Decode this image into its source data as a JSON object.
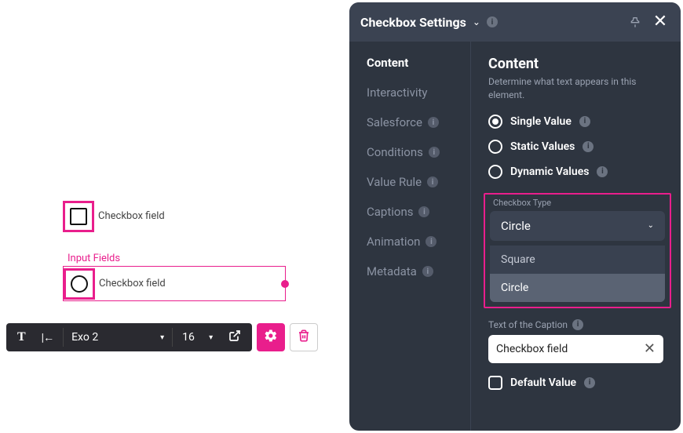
{
  "canvas": {
    "square_field_label": "Checkbox field",
    "group_label": "Input Fields",
    "circle_field_label": "Checkbox field"
  },
  "toolbar": {
    "font_name": "Exo 2",
    "font_size": "16"
  },
  "panel": {
    "title": "Checkbox Settings",
    "nav": {
      "content": "Content",
      "interactivity": "Interactivity",
      "salesforce": "Salesforce",
      "conditions": "Conditions",
      "value_rule": "Value Rule",
      "captions": "Captions",
      "animation": "Animation",
      "metadata": "Metadata"
    },
    "content": {
      "heading": "Content",
      "subtitle": "Determine what text appears in this element.",
      "radio_single": "Single Value",
      "radio_static": "Static Values",
      "radio_dynamic": "Dynamic Values",
      "checkbox_type_label": "Checkbox Type",
      "checkbox_type_value": "Circle",
      "opt_square": "Square",
      "opt_circle": "Circle",
      "caption_label": "Text of the Caption",
      "caption_value": "Checkbox field",
      "default_value_label": "Default Value"
    }
  }
}
